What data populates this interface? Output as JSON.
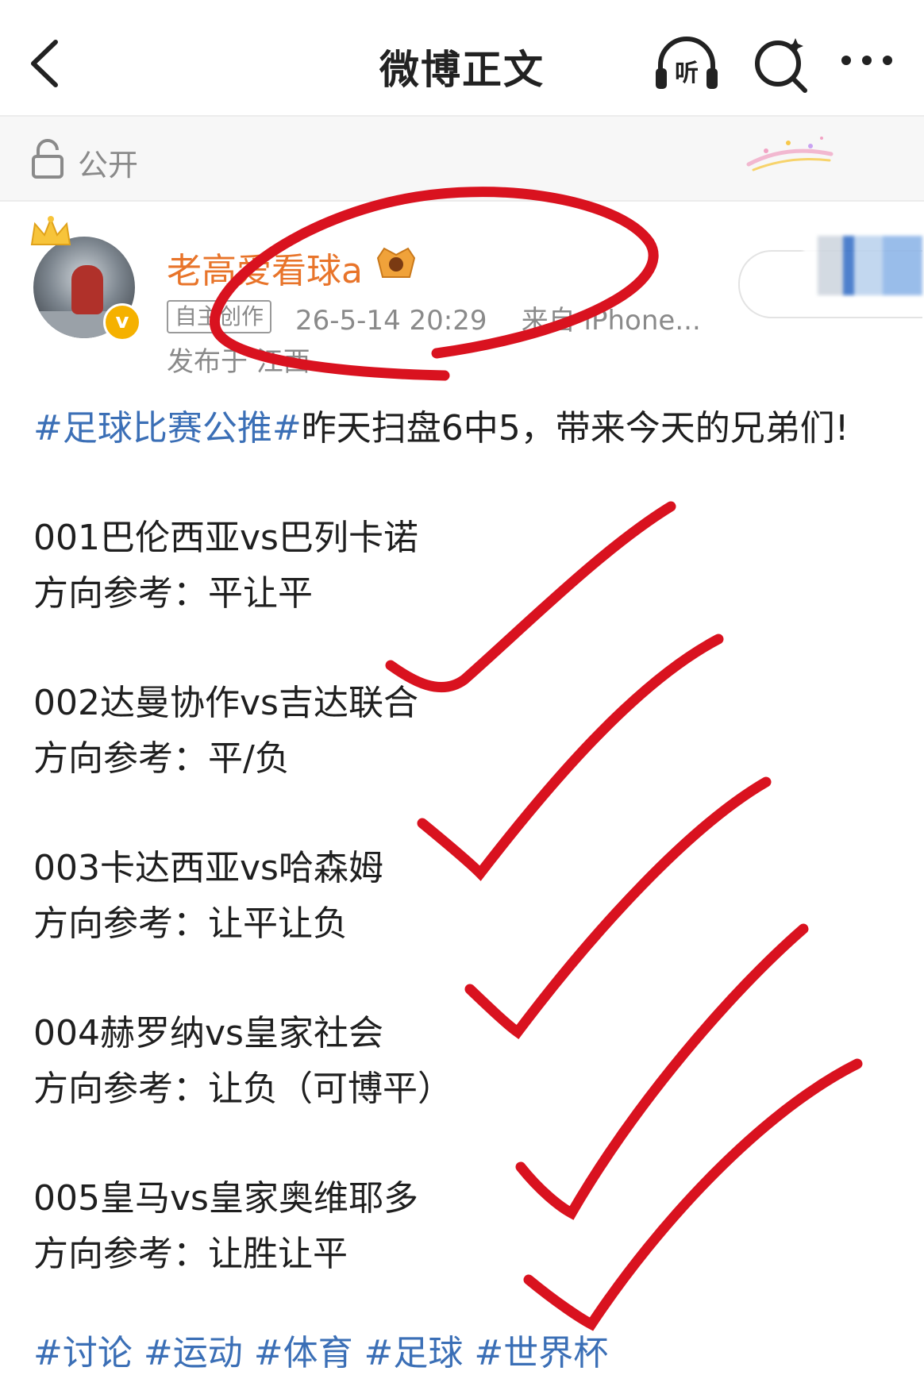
{
  "nav": {
    "title": "微博正文",
    "listen_label": "听"
  },
  "visibility": {
    "label": "公开"
  },
  "author": {
    "name": "老高爱看球a",
    "badge_v": "v",
    "tag": "自主创作",
    "timestamp": "26-5-14 20:29",
    "source": "来自 iPhone...",
    "location": "发布于 江西"
  },
  "post": {
    "intro_hashtag": "#足球比赛公推#",
    "intro_text": "昨天扫盘6中5，带来今天的兄弟们!",
    "matches": [
      {
        "title": "001巴伦西亚vs巴列卡诺",
        "advice": "方向参考：平让平"
      },
      {
        "title": "002达曼协作vs吉达联合",
        "advice": "方向参考：平/负"
      },
      {
        "title": "003卡达西亚vs哈森姆",
        "advice": "方向参考：让平让负"
      },
      {
        "title": "004赫罗纳vs皇家社会",
        "advice": "方向参考：让负（可博平）"
      },
      {
        "title": "005皇马vs皇家奥维耶多",
        "advice": "方向参考：让胜让平"
      }
    ],
    "bottom_tags": "#讨论 #运动 #体育 #足球 #世界杯"
  },
  "colors": {
    "ink": "#d9121f",
    "hashtag": "#3b6fb6",
    "username": "#e8742a"
  },
  "icons": [
    "back-icon",
    "listen-icon",
    "search-icon",
    "more-icon",
    "lock-icon",
    "crown-icon",
    "vip-icon",
    "verified-badge"
  ]
}
